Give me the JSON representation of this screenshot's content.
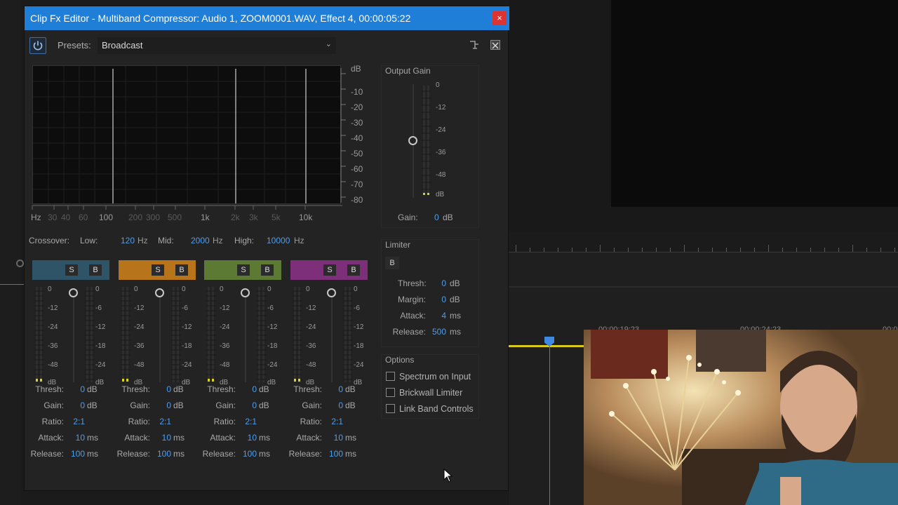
{
  "dialog": {
    "title": "Clip Fx Editor - Multiband Compressor: Audio 1, ZOOM0001.WAV, Effect 4, 00:00:05:22",
    "close_label": "×",
    "presets_label": "Presets:",
    "preset_value": "Broadcast"
  },
  "graph": {
    "db_labels": [
      "dB",
      "-10",
      "-20",
      "-30",
      "-40",
      "-50",
      "-60",
      "-70",
      "-80"
    ],
    "freq_labels": [
      {
        "text": "Hz",
        "dim": false
      },
      {
        "text": "30",
        "dim": true
      },
      {
        "text": "40",
        "dim": true
      },
      {
        "text": "60",
        "dim": true
      },
      {
        "text": "100",
        "dim": false
      },
      {
        "text": "200",
        "dim": true
      },
      {
        "text": "300",
        "dim": true
      },
      {
        "text": "500",
        "dim": true
      },
      {
        "text": "1k",
        "dim": false
      },
      {
        "text": "2k",
        "dim": true
      },
      {
        "text": "3k",
        "dim": true
      },
      {
        "text": "5k",
        "dim": true
      },
      {
        "text": "10k",
        "dim": false
      }
    ]
  },
  "crossover": {
    "label": "Crossover:",
    "low_label": "Low:",
    "low_value": "120",
    "low_unit": "Hz",
    "mid_label": "Mid:",
    "mid_value": "2000",
    "mid_unit": "Hz",
    "high_label": "High:",
    "high_value": "10000",
    "high_unit": "Hz"
  },
  "meter_scale_left": [
    "0",
    "-12",
    "-24",
    "-36",
    "-48",
    "dB"
  ],
  "meter_scale_right": [
    "0",
    "-6",
    "-12",
    "-18",
    "-24",
    "dB"
  ],
  "bands": [
    {
      "color": "#2f5468",
      "solo": "S",
      "bypass": "B",
      "thresh": "0",
      "gain": "0",
      "ratio": "2:1",
      "attack": "10",
      "release": "100"
    },
    {
      "color": "#b8741a",
      "solo": "S",
      "bypass": "B",
      "thresh": "0",
      "gain": "0",
      "ratio": "2:1",
      "attack": "10",
      "release": "100"
    },
    {
      "color": "#5d7a35",
      "solo": "S",
      "bypass": "B",
      "thresh": "0",
      "gain": "0",
      "ratio": "2:1",
      "attack": "10",
      "release": "100"
    },
    {
      "color": "#7e2f7a",
      "solo": "S",
      "bypass": "B",
      "thresh": "0",
      "gain": "0",
      "ratio": "2:1",
      "attack": "10",
      "release": "100"
    }
  ],
  "band_labels": {
    "thresh": "Thresh:",
    "gain": "Gain:",
    "ratio": "Ratio:",
    "attack": "Attack:",
    "release": "Release:",
    "db": "dB",
    "ms": "ms"
  },
  "output_gain": {
    "title": "Output Gain",
    "scale": [
      "0",
      "-12",
      "-24",
      "-36",
      "-48",
      "dB"
    ],
    "gain_label": "Gain:",
    "gain_value": "0",
    "gain_unit": "dB"
  },
  "limiter": {
    "title": "Limiter",
    "bypass": "B",
    "thresh_label": "Thresh:",
    "thresh_value": "0",
    "thresh_unit": "dB",
    "margin_label": "Margin:",
    "margin_value": "0",
    "margin_unit": "dB",
    "attack_label": "Attack:",
    "attack_value": "4",
    "attack_unit": "ms",
    "release_label": "Release:",
    "release_value": "500",
    "release_unit": "ms"
  },
  "options": {
    "title": "Options",
    "items": [
      "Spectrum on Input",
      "Brickwall Limiter",
      "Link Band Controls"
    ]
  },
  "timeline": {
    "timecodes": [
      "00;00;19;23",
      "00;00;24;23",
      "00;0"
    ]
  },
  "colors": {
    "accent": "#1f7fd8",
    "value_blue": "#4f9dea",
    "meter_yellow": "#d9d21e"
  }
}
